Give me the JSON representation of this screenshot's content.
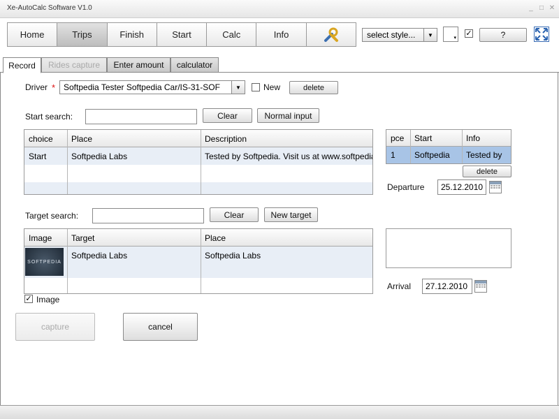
{
  "window": {
    "title": "Xe-AutoCalc Software V1.0",
    "min": "_",
    "max": "□",
    "close": "✕"
  },
  "nav": {
    "items": [
      "Home",
      "Trips",
      "Finish",
      "Start",
      "Calc",
      "Info"
    ],
    "active_index": 1
  },
  "toolbar": {
    "style_select": "select style...",
    "help_label": "?"
  },
  "tabs": [
    {
      "label": "Record",
      "state": "active"
    },
    {
      "label": "Rides capture",
      "state": "disabled"
    },
    {
      "label": "Enter amount",
      "state": "normal"
    },
    {
      "label": "calculator",
      "state": "normal"
    }
  ],
  "driver": {
    "label": "Driver",
    "required_mark": "*",
    "value": "Softpedia Tester Softpedia Car/IS-31-SOF",
    "new_label": "New",
    "delete_label": "delete"
  },
  "start_search": {
    "label": "Start search:",
    "value": "",
    "clear_label": "Clear",
    "normal_input_label": "Normal input"
  },
  "start_table": {
    "headers": [
      "choice",
      "Place",
      "Description"
    ],
    "rows": [
      [
        "Start",
        "Softpedia Labs",
        "Tested by Softpedia. Visit us at www.softpedia.com"
      ]
    ]
  },
  "pce_table": {
    "headers": [
      "pce",
      "Start",
      "Info"
    ],
    "rows": [
      [
        "1",
        "Softpedia",
        "Tested by"
      ]
    ],
    "delete_label": "delete"
  },
  "departure": {
    "label": "Departure",
    "value": "25.12.2010"
  },
  "target_search": {
    "label": "Target search:",
    "value": "",
    "clear_label": "Clear",
    "new_target_label": "New target"
  },
  "target_table": {
    "headers": [
      "Image",
      "Target",
      "Place"
    ],
    "rows": [
      [
        "",
        "Softpedia Labs",
        "Softpedia Labs"
      ]
    ],
    "thumbnail_text": "SOFTPEDIA"
  },
  "arrival": {
    "label": "Arrival",
    "value": "27.12.2010"
  },
  "image_checkbox": {
    "label": "Image",
    "checked": true
  },
  "actions": {
    "capture_label": "capture",
    "cancel_label": "cancel"
  },
  "colors": {
    "selected_row": "#a8c4e6",
    "alt_row": "#e8eef6",
    "active_nav": "#c4c4c4"
  }
}
